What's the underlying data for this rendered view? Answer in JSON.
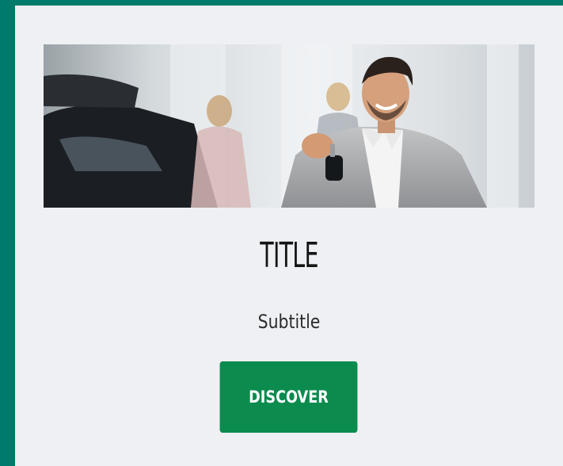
{
  "card": {
    "title": "TITLE",
    "subtitle": "Subtitle",
    "button_label": "DISCOVER"
  },
  "hero": {
    "image_semantic": "car-dealer-holding-keys-photo"
  },
  "colors": {
    "outer_frame": "#007a6b",
    "card_background": "#eef0f3",
    "button_background": "#0b8b4e",
    "button_text": "#ffffff",
    "title_text": "#151515"
  }
}
